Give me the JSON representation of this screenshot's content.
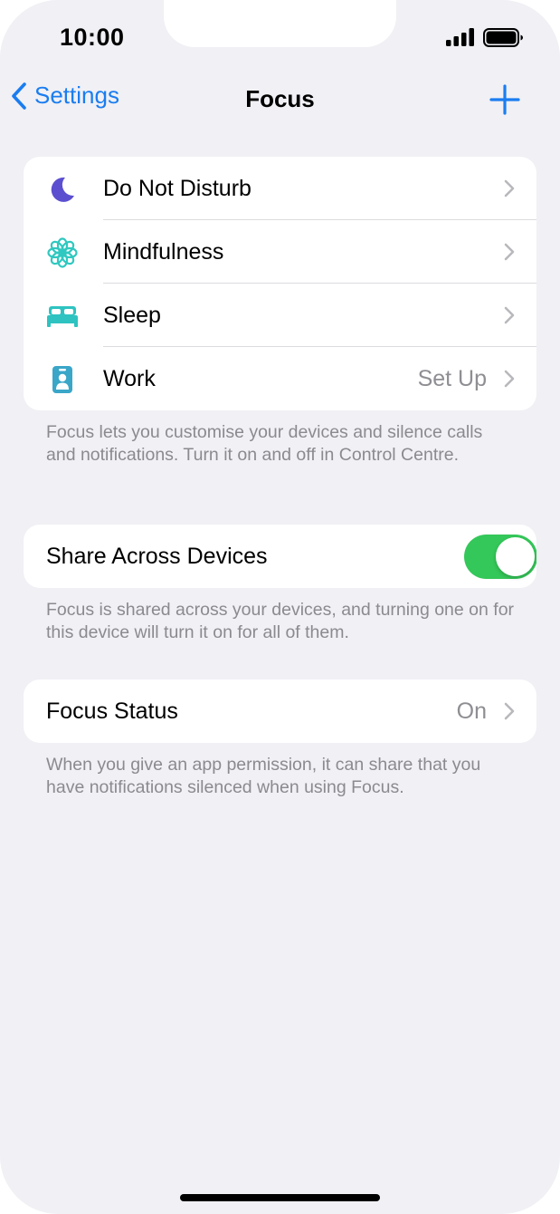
{
  "status_bar": {
    "time": "10:00"
  },
  "nav": {
    "back_label": "Settings",
    "title": "Focus"
  },
  "focus_modes": [
    {
      "label": "Do Not Disturb",
      "icon": "moon-icon",
      "value": ""
    },
    {
      "label": "Mindfulness",
      "icon": "flower-icon",
      "value": ""
    },
    {
      "label": "Sleep",
      "icon": "bed-icon",
      "value": ""
    },
    {
      "label": "Work",
      "icon": "id-badge-icon",
      "value": "Set Up"
    }
  ],
  "focus_footnote": "Focus lets you customise your devices and silence calls and notifications. Turn it on and off in Control Centre.",
  "share": {
    "label": "Share Across Devices",
    "enabled": true,
    "footnote": "Focus is shared across your devices, and turning one on for this device will turn it on for all of them."
  },
  "status": {
    "label": "Focus Status",
    "value": "On",
    "footnote": "When you give an app permission, it can share that you have notifications silenced when using Focus."
  },
  "colors": {
    "accent": "#1a7df0",
    "moon": "#5b4fd0",
    "mindfulness": "#30c8c0",
    "sleep": "#2ec3c0",
    "work": "#3aa6c8",
    "toggle_on": "#34c759"
  }
}
